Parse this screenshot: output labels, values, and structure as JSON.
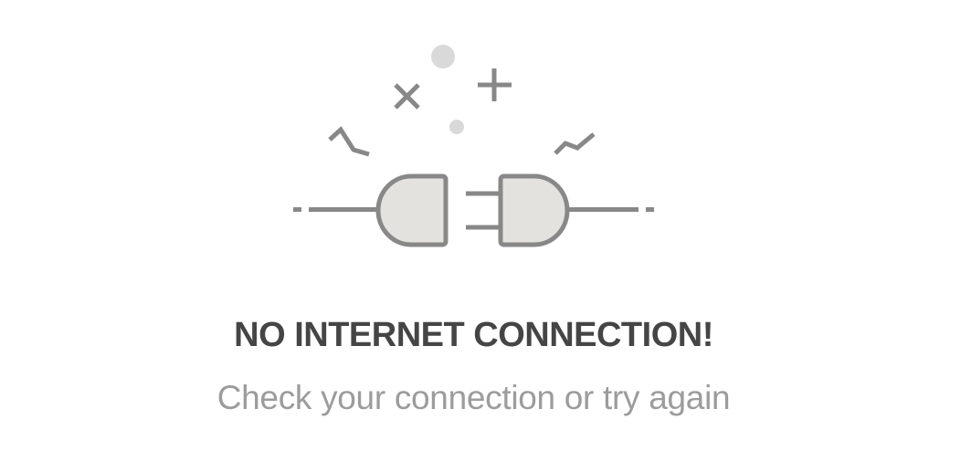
{
  "error_state": {
    "illustration_icon": "unplugged-power-plug-icon",
    "title": "NO INTERNET CONNECTION!",
    "subtitle": "Check your connection or try again"
  },
  "colors": {
    "background": "#ffffff",
    "title_text": "#454545",
    "subtitle_text": "#9c9c9c",
    "icon_stroke": "#888888",
    "icon_fill": "#e3e2de",
    "dots": "#d9d9d9"
  }
}
